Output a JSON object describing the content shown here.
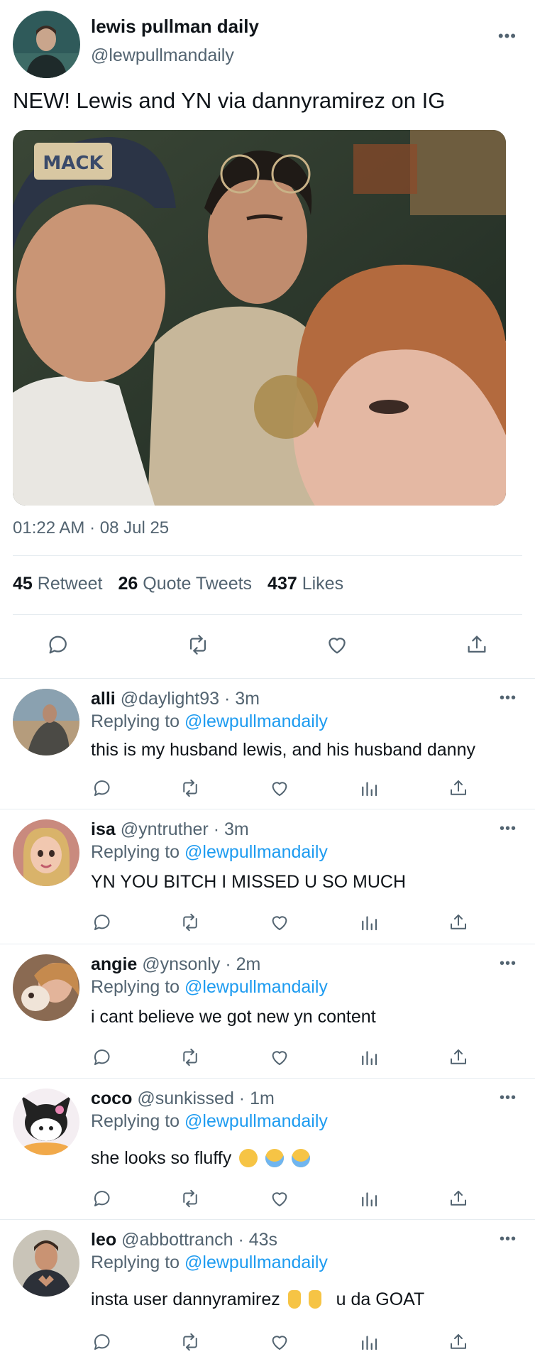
{
  "main": {
    "author_name": "lewis pullman daily",
    "author_handle": "@lewpullmandaily",
    "more": "•••",
    "text": "NEW! Lewis and YN via dannyramirez on IG",
    "photo_cap_text": "MACK",
    "timestamp": "01:22 AM · 08 Jul 25",
    "stats": {
      "retweets_count": "45",
      "retweets_label": "Retweet",
      "quotes_count": "26",
      "quotes_label": "Quote Tweets",
      "likes_count": "437",
      "likes_label": "Likes"
    },
    "actions": [
      "reply-icon",
      "retweet-icon",
      "like-icon",
      "share-icon"
    ]
  },
  "replies": [
    {
      "name": "alli",
      "meta": "@daylight93 · 3m",
      "replying_prefix": "Replying to",
      "replying_to": "@lewpullmandaily",
      "text": "this is my husband lewis, and his husband danny",
      "more": "•••"
    },
    {
      "name": "isa",
      "meta": "@yntruther · 3m",
      "replying_prefix": "Replying to",
      "replying_to": "@lewpullmandaily",
      "text": "YN YOU BITCH I MISSED U SO MUCH",
      "more": "•••"
    },
    {
      "name": "angie",
      "meta": "@ynsonly · 2m",
      "replying_prefix": "Replying to",
      "replying_to": "@lewpullmandaily",
      "text": "i cant believe we got new yn content",
      "more": "•••"
    },
    {
      "name": "coco",
      "meta": "@sunkissed · 1m",
      "replying_prefix": "Replying to",
      "replying_to": "@lewpullmandaily",
      "text": "she looks so fluffy",
      "emojis": [
        "pleading-face-emoji",
        "crying-face-emoji",
        "crying-face-emoji"
      ],
      "more": "•••"
    },
    {
      "name": "leo",
      "meta": "@abbottranch · 43s",
      "replying_prefix": "Replying to",
      "replying_to": "@lewpullmandaily",
      "text_before": "insta user dannyramirez",
      "emojis": [
        "pointing-up-emoji",
        "pointing-up-emoji"
      ],
      "text_after": "u da GOAT",
      "more": "•••"
    }
  ],
  "colors": {
    "text": "#0f1419",
    "secondary": "#536471",
    "link": "#1d9bf0",
    "divider": "#e6ecf0"
  }
}
